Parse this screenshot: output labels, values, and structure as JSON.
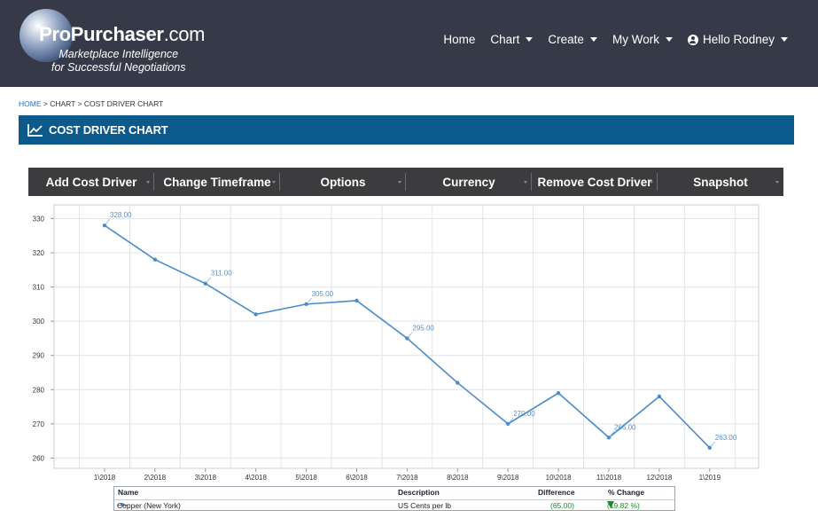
{
  "brand": {
    "name_main": "ProPurchaser",
    "name_suffix": ".com",
    "tagline_1": "Marketplace Intelligence",
    "tagline_2": "for Successful Negotiations"
  },
  "nav": {
    "home": "Home",
    "chart": "Chart",
    "create": "Create",
    "my_work": "My Work",
    "user": "Hello Rodney"
  },
  "breadcrumb": {
    "home": "HOME",
    "sep1": " > ",
    "chart": "CHART",
    "sep2": " > ",
    "current": "COST DRIVER CHART"
  },
  "page_title": "COST DRIVER CHART",
  "toolbar": {
    "add": "Add Cost Driver",
    "timeframe": "Change Timeframe",
    "options": "Options",
    "currency": "Currency",
    "remove": "Remove Cost Driver",
    "snapshot": "Snapshot"
  },
  "chart_data": {
    "type": "line",
    "categories": [
      "1\\2018",
      "2\\2018",
      "3\\2018",
      "4\\2018",
      "5\\2018",
      "6\\2018",
      "7\\2018",
      "8\\2018",
      "9\\2018",
      "10\\2018",
      "11\\2018",
      "12\\2018",
      "1\\2019"
    ],
    "series": [
      {
        "name": "Copper (New York)",
        "values": [
          328,
          318,
          311,
          302,
          305,
          306,
          295,
          282,
          270,
          279,
          266,
          278,
          263
        ]
      }
    ],
    "point_labels": [
      {
        "index": 0,
        "text": "328.00"
      },
      {
        "index": 2,
        "text": "311.00"
      },
      {
        "index": 4,
        "text": "305.00"
      },
      {
        "index": 6,
        "text": "295.00"
      },
      {
        "index": 8,
        "text": "270.00"
      },
      {
        "index": 10,
        "text": "266.00"
      },
      {
        "index": 12,
        "text": "263.00"
      }
    ],
    "yticks": [
      260,
      270,
      280,
      290,
      300,
      310,
      320,
      330
    ],
    "ylim": [
      257,
      334
    ],
    "grid": true,
    "line_color": "#4a8ccb"
  },
  "legend": {
    "headers": {
      "name": "Name",
      "description": "Description",
      "difference": "Difference",
      "pct_change": "% Change"
    },
    "rows": [
      {
        "name": "Copper (New York)",
        "description": "US Cents per lb",
        "difference": "(65.00)",
        "pct_change": "(19.82 %)"
      }
    ]
  },
  "colors": {
    "header_bg": "#363a48",
    "title_bg": "#0c5a8c",
    "toolbar_bg": "#3c3c3e",
    "line": "#4a8ccb",
    "down": "#1a8a2a"
  }
}
